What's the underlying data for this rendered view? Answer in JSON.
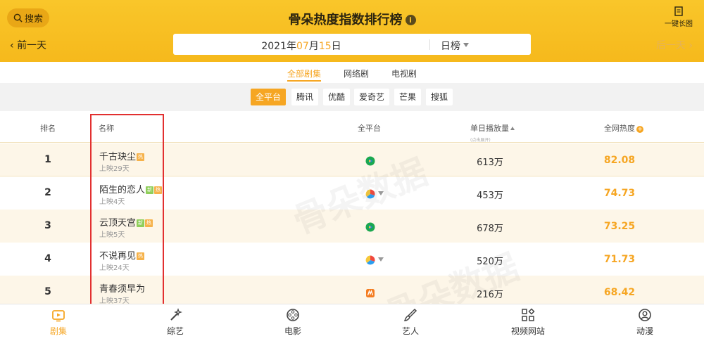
{
  "header": {
    "search_label": "搜索",
    "title": "骨朵热度指数排行榜",
    "info_icon": "i",
    "long_image_label": "一键长图",
    "prev_day": "前一天",
    "next_day": "后一天",
    "date_year": "2021年",
    "date_month": "07",
    "date_month_unit": "月",
    "date_day": "15",
    "date_day_unit": "日",
    "period": "日榜"
  },
  "category_tabs": [
    "全部剧集",
    "网络剧",
    "电视剧"
  ],
  "platform_tabs": [
    "全平台",
    "腾讯",
    "优酷",
    "爱奇艺",
    "芒果",
    "搜狐"
  ],
  "table": {
    "col_rank": "排名",
    "col_name": "名称",
    "col_platform": "全平台",
    "col_plays": "单日播放量",
    "col_plays_note": "(点击展开)",
    "col_heat": "全网热度",
    "rows": [
      {
        "rank": "1",
        "name": "千古玦尘",
        "badges": [
          "热"
        ],
        "sub": "上映29天",
        "platform_icon": "tencent-video-icon",
        "plays": "613万",
        "heat": "82.08"
      },
      {
        "rank": "2",
        "name": "陌生的恋人",
        "badges": [
          "新",
          "热"
        ],
        "sub": "上映4天",
        "platform_icon": "multi-platform-icon",
        "plays": "453万",
        "heat": "74.73"
      },
      {
        "rank": "3",
        "name": "云顶天宫",
        "badges": [
          "新",
          "热"
        ],
        "sub": "上映5天",
        "platform_icon": "tencent-video-icon",
        "plays": "678万",
        "heat": "73.25"
      },
      {
        "rank": "4",
        "name": "不说再见",
        "badges": [
          "热"
        ],
        "sub": "上映24天",
        "platform_icon": "multi-platform-icon",
        "plays": "520万",
        "heat": "71.73"
      },
      {
        "rank": "5",
        "name": "青春须早为",
        "badges": [],
        "sub": "上映37天",
        "platform_icon": "mango-tv-icon",
        "plays": "216万",
        "heat": "68.42"
      }
    ]
  },
  "watermark": "骨朵数据",
  "bottom_nav": [
    "剧集",
    "综艺",
    "电影",
    "艺人",
    "视频网站",
    "动漫"
  ],
  "colors": {
    "accent": "#f6a623",
    "header": "#f8c12a",
    "highlight_box": "#e23030"
  }
}
